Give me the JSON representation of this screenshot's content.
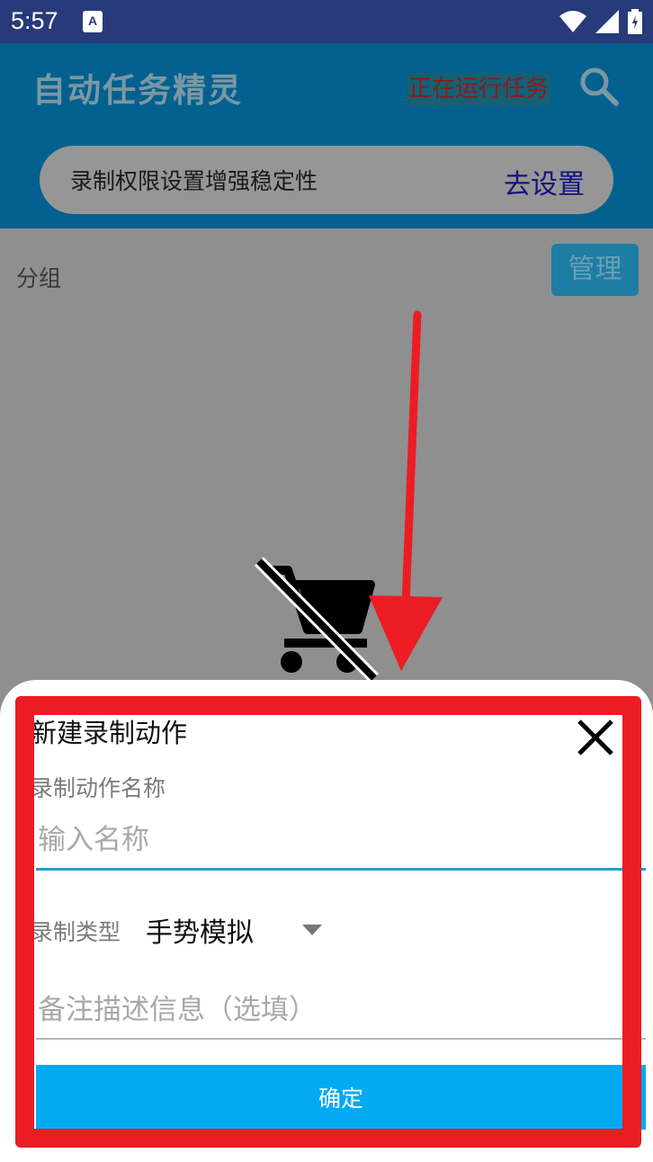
{
  "status_bar": {
    "time": "5:57",
    "app_icon_letter": "A",
    "icons": [
      "wifi-icon",
      "signal-icon",
      "battery-icon"
    ]
  },
  "app_bar": {
    "title": "自动任务精灵",
    "running_badge": "正在运行任务",
    "search_icon": "search-icon"
  },
  "banner": {
    "text": "录制权限设置增强稳定性",
    "link": "去设置"
  },
  "group": {
    "label": "分组",
    "manage_button": "管理"
  },
  "empty_state": {
    "icon": "remove-shopping-cart-icon"
  },
  "dialog": {
    "title": "新建录制动作",
    "close_icon": "close-icon",
    "name_label": "录制动作名称",
    "name_placeholder": "输入名称",
    "name_value": "",
    "type_label": "录制类型",
    "type_value": "手势模拟",
    "description_placeholder": "备注描述信息（选填）",
    "description_value": "",
    "confirm_button": "确定"
  },
  "colors": {
    "status_bar": "#283a79",
    "app_bar": "#02618e",
    "accent": "#02a9f3",
    "input_focus": "#1e9fd4",
    "annotation_red": "#ec1c24",
    "link": "#13137c"
  }
}
